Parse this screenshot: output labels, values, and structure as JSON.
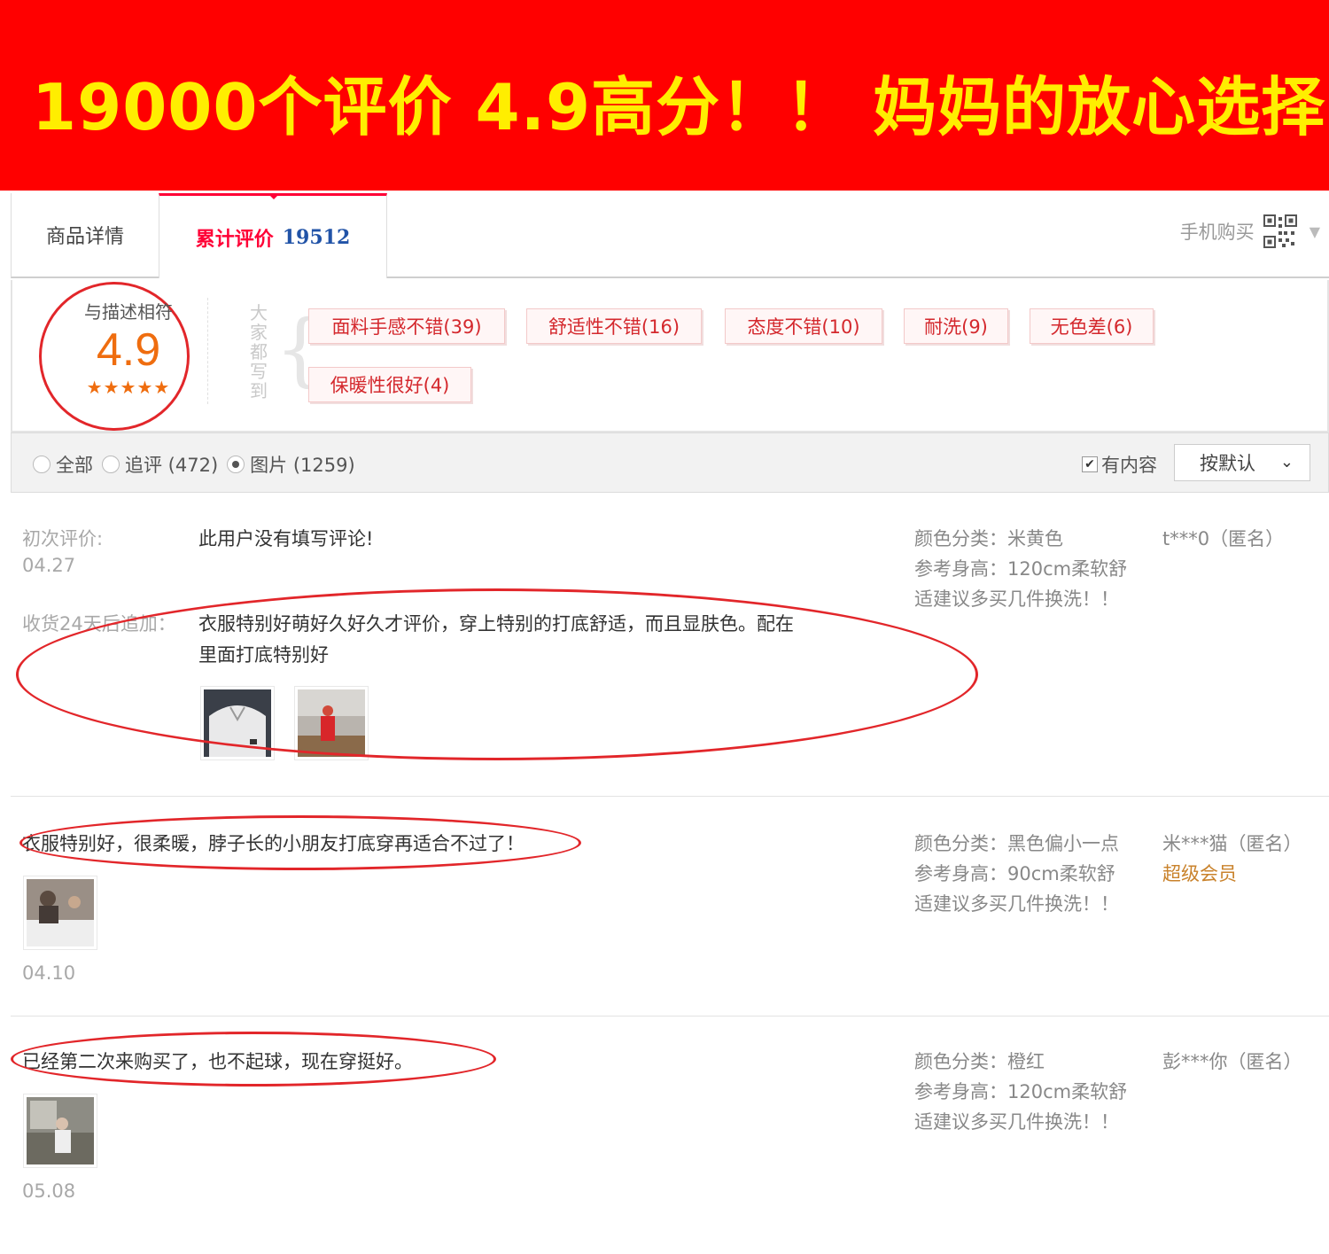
{
  "banner": {
    "text": "19000个评价 4.9高分！！ 妈妈的放心选择"
  },
  "tabs": {
    "detail_label": "商品详情",
    "reviews_label": "累计评价",
    "reviews_count": "19512",
    "mobile_buy": "手机购买"
  },
  "summary": {
    "score_label": "与描述相符",
    "score_value": "4.9",
    "score_stars": "★★★★★",
    "everyone_wrote": "大家都写到",
    "tags": [
      "面料手感不错(39)",
      "舒适性不错(16)",
      "态度不错(10)",
      "耐洗(9)",
      "无色差(6)",
      "保暖性很好(4)"
    ]
  },
  "filter": {
    "all": "全部",
    "followup": "追评 (472)",
    "pictures": "图片 (1259)",
    "has_content": "有内容",
    "sort": "按默认"
  },
  "reviews": [
    {
      "first_label": "初次评价:",
      "date": "04.27",
      "content": "此用户没有填写评论!",
      "followup_label": "收货24天后追加：",
      "followup_line1": "衣服特别好萌好久好久才评价，穿上特别的打底舒适，而且显肤色。配在",
      "followup_line2": "里面打底特别好",
      "color": "颜色分类：米黄色",
      "height": "参考身高：120cm柔软舒",
      "note": "适建议多买几件换洗！！",
      "user": "t***0（匿名）"
    },
    {
      "content": "衣服特别好，很柔暖，脖子长的小朋友打底穿再适合不过了！",
      "date": "04.10",
      "color": "颜色分类：黑色偏小一点",
      "height": "参考身高：90cm柔软舒",
      "note": "适建议多买几件换洗！！",
      "user": "米***猫（匿名）",
      "badge": "超级会员"
    },
    {
      "content": "已经第二次来购买了，也不起球，现在穿挺好。",
      "date": "05.08",
      "color": "颜色分类：橙红",
      "height": "参考身高：120cm柔软舒",
      "note": "适建议多买几件换洗！！",
      "user": "彭***你（匿名）"
    }
  ],
  "colors": {
    "banner_bg": "#ff0000",
    "banner_text": "#ffee00",
    "accent": "#ff0036",
    "count_blue": "#2153a7",
    "score_orange": "#ef6d0f",
    "annotation_red": "#e2262a",
    "tag_text": "#d4282d",
    "member": "#c9822b"
  }
}
